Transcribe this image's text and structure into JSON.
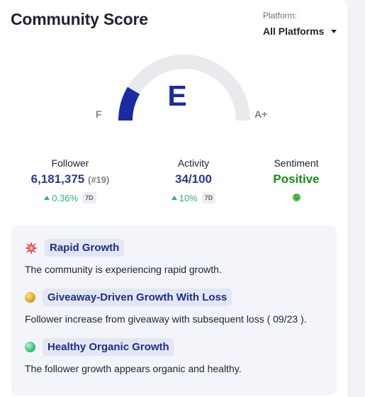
{
  "header": {
    "title": "Community Score",
    "platform_label": "Platform:",
    "platform_value": "All Platforms"
  },
  "gauge": {
    "grade": "E",
    "min_label": "F",
    "max_label": "A+",
    "fill_fraction": 0.17,
    "colors": {
      "fill": "#1b2ba3",
      "track": "#e9eaee"
    }
  },
  "stats": {
    "follower": {
      "label": "Follower",
      "value": "6,181,375",
      "rank": "(#19)",
      "change": "0.36%",
      "period": "7D"
    },
    "activity": {
      "label": "Activity",
      "value": "34/100",
      "change": "10%",
      "period": "7D"
    },
    "sentiment": {
      "label": "Sentiment",
      "value": "Positive",
      "icon": "smiley-icon"
    }
  },
  "insights": [
    {
      "title": "Rapid Growth",
      "description": "The community is experiencing rapid growth.",
      "icon": "burst-icon"
    },
    {
      "title": "Giveaway-Driven Growth With Loss",
      "description": "Follower increase from giveaway with subsequent loss ( 09/23 ).",
      "icon": "yellow-ball-icon"
    },
    {
      "title": "Healthy Organic Growth",
      "description": "The follower growth appears organic and healthy.",
      "icon": "green-ball-icon"
    }
  ]
}
